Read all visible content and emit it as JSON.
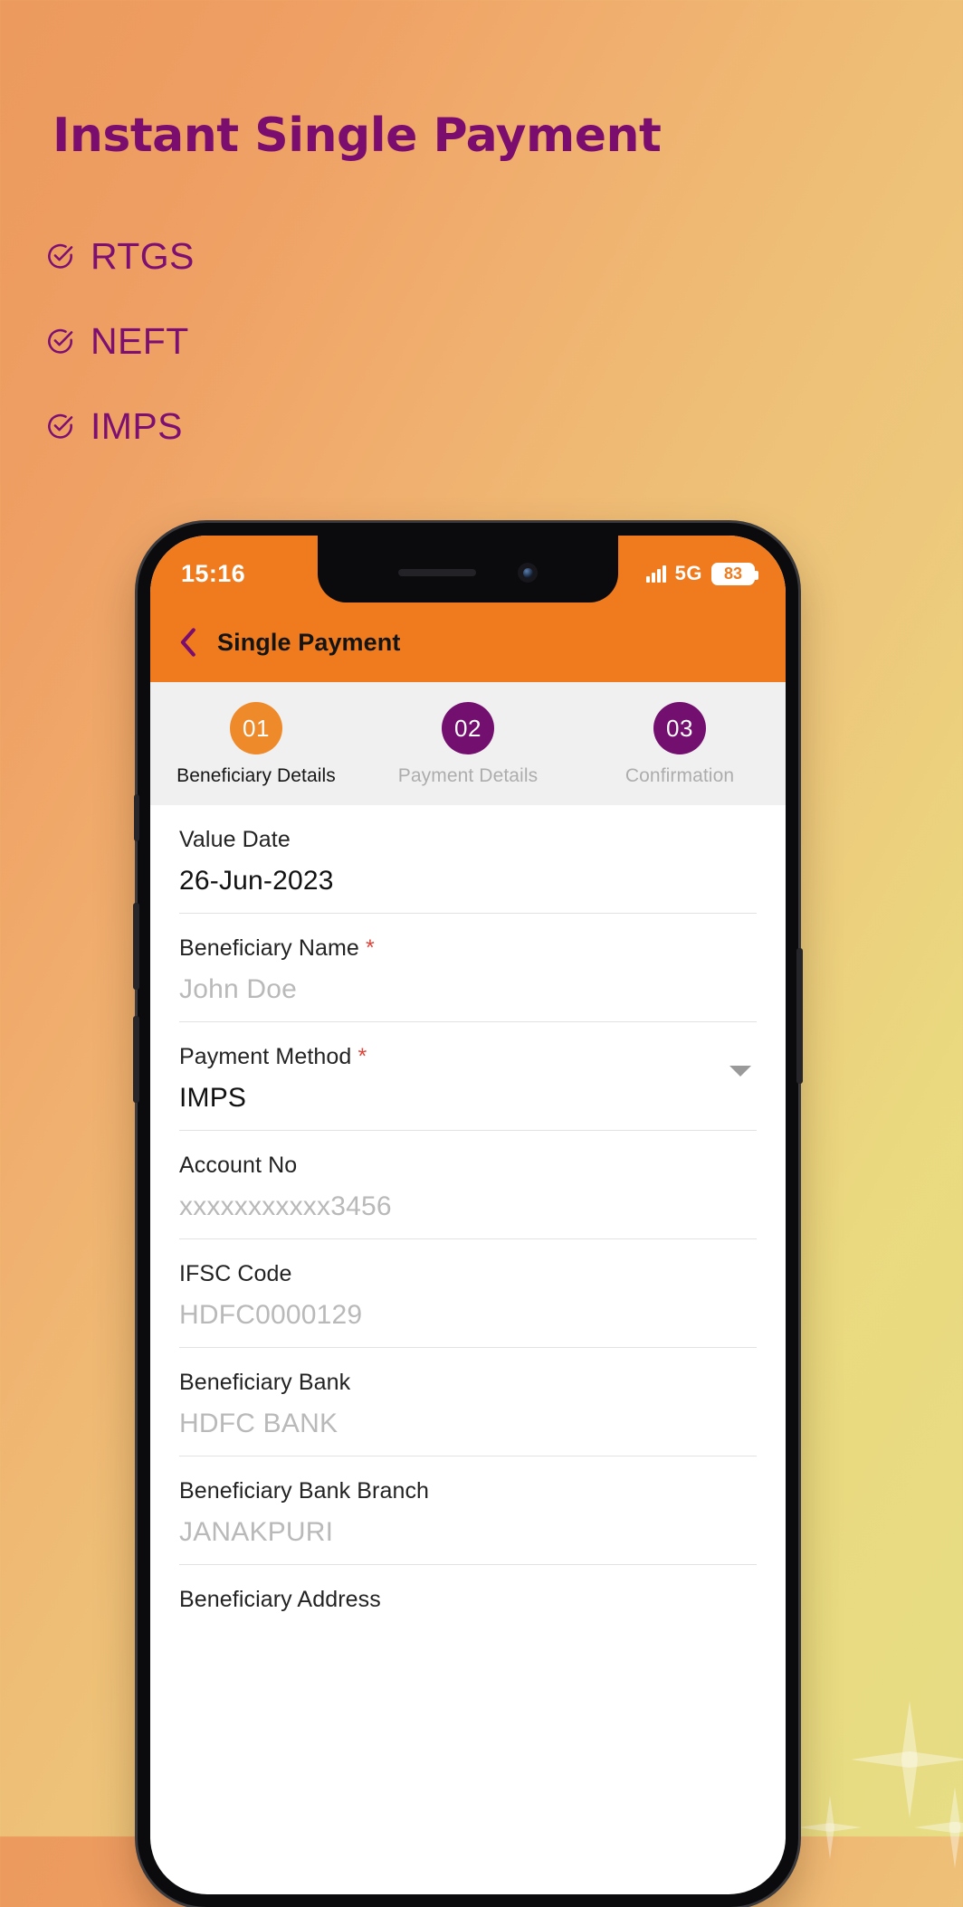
{
  "promo": {
    "headline": "Instant Single Payment",
    "features": [
      {
        "icon": "check-circle-icon",
        "label": "RTGS"
      },
      {
        "icon": "check-circle-icon",
        "label": "NEFT"
      },
      {
        "icon": "check-circle-icon",
        "label": "IMPS"
      }
    ]
  },
  "phone": {
    "status_bar": {
      "time": "15:16",
      "network": "5G",
      "battery_level": "83"
    },
    "app_bar": {
      "back_icon": "chevron-left-icon",
      "title": "Single Payment"
    },
    "stepper": {
      "steps": [
        {
          "number": "01",
          "label": "Beneficiary Details",
          "state": "active"
        },
        {
          "number": "02",
          "label": "Payment Details",
          "state": "pending"
        },
        {
          "number": "03",
          "label": "Confirmation",
          "state": "pending"
        }
      ]
    },
    "form": {
      "fields": [
        {
          "label": "Value Date",
          "required": false,
          "value": "26-Jun-2023",
          "state": "filled",
          "control": "date"
        },
        {
          "label": "Beneficiary Name",
          "required": true,
          "value": "John Doe",
          "state": "placeholder",
          "control": "text"
        },
        {
          "label": "Payment Method",
          "required": true,
          "value": "IMPS",
          "state": "filled",
          "control": "dropdown"
        },
        {
          "label": "Account No",
          "required": false,
          "value": "xxxxxxxxxxx3456",
          "state": "placeholder",
          "control": "text"
        },
        {
          "label": "IFSC Code",
          "required": false,
          "value": "HDFC0000129",
          "state": "placeholder",
          "control": "text"
        },
        {
          "label": "Beneficiary Bank",
          "required": false,
          "value": "HDFC BANK",
          "state": "placeholder",
          "control": "text"
        },
        {
          "label": "Beneficiary Bank Branch",
          "required": false,
          "value": "JANAKPURI",
          "state": "placeholder",
          "control": "text"
        },
        {
          "label": "Beneficiary Address",
          "required": false,
          "value": "",
          "state": "placeholder",
          "control": "text"
        }
      ]
    }
  },
  "colors": {
    "brand_purple": "#7a0d6e",
    "brand_orange": "#ef7b1e",
    "step_active": "#ef8a2a",
    "step_pending": "#730f6e",
    "required_star": "#e0453b"
  }
}
